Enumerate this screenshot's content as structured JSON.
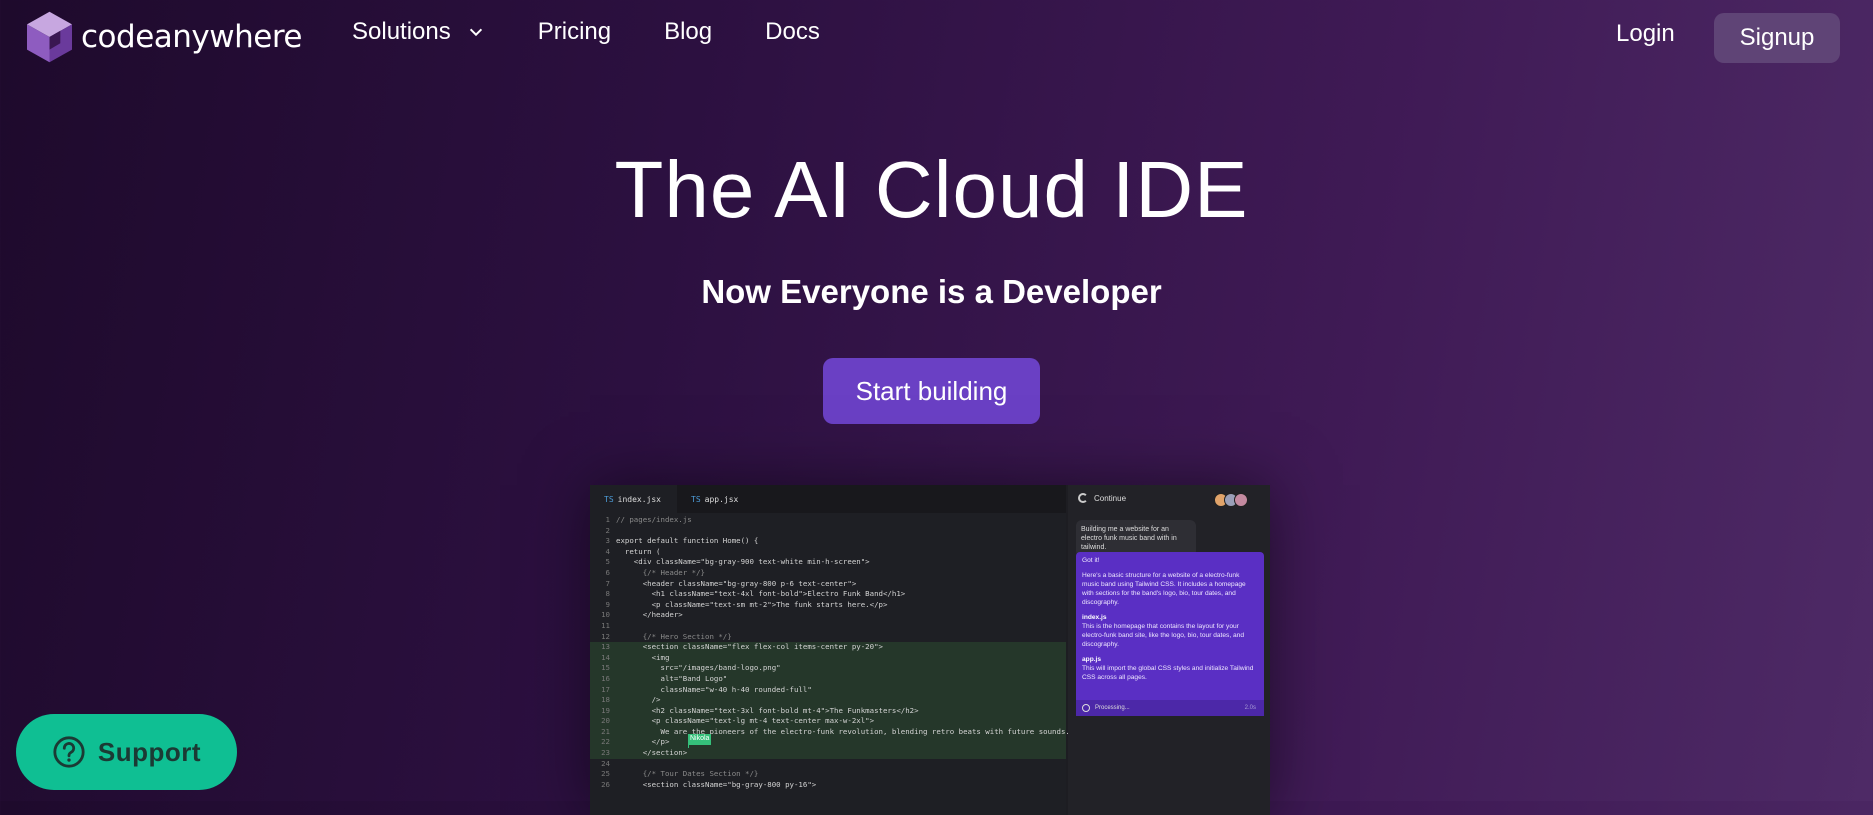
{
  "nav": {
    "logo_text": "codeanywhere",
    "links": [
      "Solutions",
      "Pricing",
      "Blog",
      "Docs"
    ],
    "login": "Login",
    "signup": "Signup"
  },
  "hero": {
    "title": "The AI Cloud IDE",
    "subtitle": "Now Everyone is a Developer",
    "cta": "Start building"
  },
  "editor": {
    "tabs": [
      {
        "lang": "TS",
        "name": "index.jsx"
      },
      {
        "lang": "TS",
        "name": "app.jsx"
      }
    ],
    "cursor_user": "Nikola",
    "lines": [
      {
        "n": "1",
        "text": "// pages/index.js"
      },
      {
        "n": "2",
        "text": ""
      },
      {
        "n": "3",
        "text": "export default function Home() {"
      },
      {
        "n": "4",
        "text": "  return ("
      },
      {
        "n": "5",
        "text": "    <div className=\"bg-gray-900 text-white min-h-screen\">"
      },
      {
        "n": "6",
        "text": "      {/* Header */}"
      },
      {
        "n": "7",
        "text": "      <header className=\"bg-gray-800 p-6 text-center\">"
      },
      {
        "n": "8",
        "text": "        <h1 className=\"text-4xl font-bold\">Electro Funk Band</h1>"
      },
      {
        "n": "9",
        "text": "        <p className=\"text-sm mt-2\">The funk starts here.</p>"
      },
      {
        "n": "10",
        "text": "      </header>"
      },
      {
        "n": "11",
        "text": ""
      },
      {
        "n": "12",
        "text": "      {/* Hero Section */}"
      },
      {
        "n": "13",
        "text": "      <section className=\"flex flex-col items-center py-20\">"
      },
      {
        "n": "14",
        "text": "        <img"
      },
      {
        "n": "15",
        "text": "          src=\"/images/band-logo.png\""
      },
      {
        "n": "16",
        "text": "          alt=\"Band Logo\""
      },
      {
        "n": "17",
        "text": "          className=\"w-40 h-40 rounded-full\""
      },
      {
        "n": "18",
        "text": "        />"
      },
      {
        "n": "19",
        "text": "        <h2 className=\"text-3xl font-bold mt-4\">The Funkmasters</h2>"
      },
      {
        "n": "20",
        "text": "        <p className=\"text-lg mt-4 text-center max-w-2xl\">"
      },
      {
        "n": "21",
        "text": "          We are the pioneers of the electro-funk revolution, blending retro beats with future sounds."
      },
      {
        "n": "22",
        "text": "        </p>"
      },
      {
        "n": "23",
        "text": "      </section>"
      },
      {
        "n": "24",
        "text": ""
      },
      {
        "n": "25",
        "text": "      {/* Tour Dates Section */}"
      },
      {
        "n": "26",
        "text": "      <section className=\"bg-gray-800 py-16\">"
      }
    ]
  },
  "chat": {
    "title": "Continue",
    "user_message": "Building me a website for an electro funk music band with in tailwind.",
    "bot_intro": "Got it!",
    "bot_desc": "Here's a basic structure for a website of a electro-funk music band using Tailwind CSS. It includes a homepage with sections for the band's logo, bio, tour dates, and discography.",
    "file1_name": "index.js",
    "file1_desc": "This is the homepage that contains the layout for your electro-funk band site, like the logo, bio, tour dates, and discography.",
    "file2_name": "app.js",
    "file2_desc": "This will import the global CSS styles and initialize Tailwind CSS across all pages.",
    "status": "Processing...",
    "status_time": "2.0s"
  },
  "support": {
    "label": "Support"
  },
  "colors": {
    "cta": "#6a40c4",
    "signup_bg": "#5f4476",
    "support_bg": "#0fbf93"
  }
}
